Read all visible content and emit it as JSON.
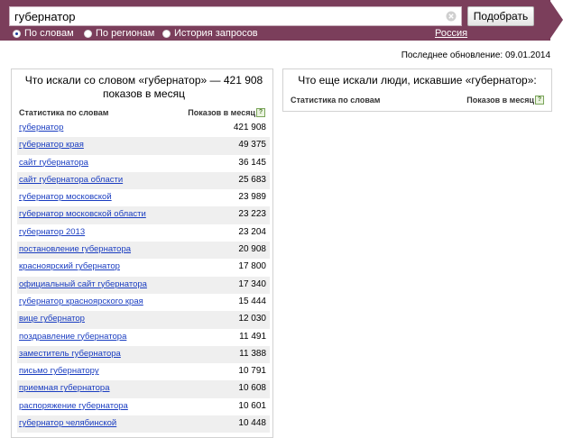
{
  "search": {
    "query": "губернатор",
    "submit_label": "Подобрать",
    "modes": [
      "По словам",
      "По регионам",
      "История запросов"
    ],
    "selected_mode": "По словам",
    "region_label": "Россия"
  },
  "last_update": "Последнее обновление: 09.01.2014",
  "left_panel": {
    "title": "Что искали со словом «губернатор» — 421 908 показов в месяц",
    "col_phrase": "Статистика по словам",
    "col_count": "Показов в месяц",
    "help_glyph": "?",
    "rows": [
      {
        "phrase": "губернатор",
        "count": "421 908"
      },
      {
        "phrase": "губернатор края",
        "count": "49 375"
      },
      {
        "phrase": "сайт губернатора",
        "count": "36 145"
      },
      {
        "phrase": "сайт губернатора области",
        "count": "25 683"
      },
      {
        "phrase": "губернатор московской",
        "count": "23 989"
      },
      {
        "phrase": "губернатор московской области",
        "count": "23 223"
      },
      {
        "phrase": "губернатор 2013",
        "count": "23 204"
      },
      {
        "phrase": "постановление губернатора",
        "count": "20 908"
      },
      {
        "phrase": "красноярский губернатор",
        "count": "17 800"
      },
      {
        "phrase": "официальный сайт губернатора",
        "count": "17 340"
      },
      {
        "phrase": "губернатор красноярского края",
        "count": "15 444"
      },
      {
        "phrase": "вице губернатор",
        "count": "12 030"
      },
      {
        "phrase": "поздравление губернатора",
        "count": "11 491"
      },
      {
        "phrase": "заместитель губернатора",
        "count": "11 388"
      },
      {
        "phrase": "письмо губернатору",
        "count": "10 791"
      },
      {
        "phrase": "приемная губернатора",
        "count": "10 608"
      },
      {
        "phrase": "распоряжение губернатора",
        "count": "10 601"
      },
      {
        "phrase": "губернатор челябинской",
        "count": "10 448"
      }
    ]
  },
  "right_panel": {
    "title": "Что еще искали люди, искавшие «губернатор»:",
    "col_phrase": "Статистика по словам",
    "col_count": "Показов в месяц",
    "help_glyph": "?"
  },
  "colors": {
    "header_bg": "#7b3e5b",
    "link": "#1a3dc1",
    "alt_row": "#efefef"
  }
}
